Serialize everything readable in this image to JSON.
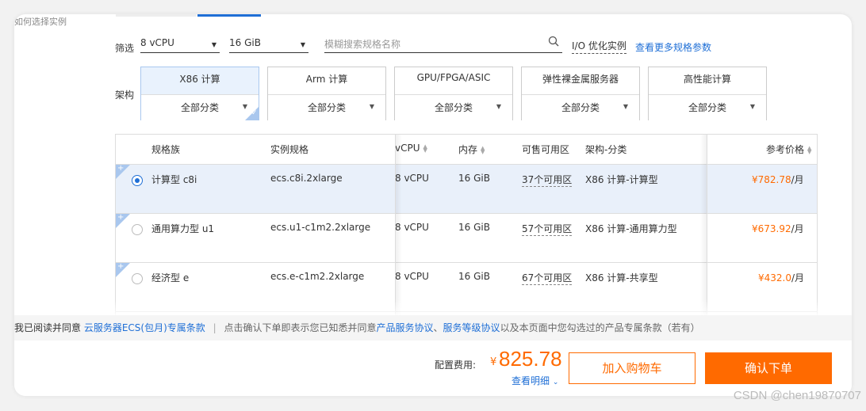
{
  "section_title": "如何选择实例",
  "filter": {
    "label": "筛选",
    "vcpu": "8 vCPU",
    "memory": "16 GiB",
    "search_placeholder": "模糊搜索规格名称",
    "io_optimized": "I/O 优化实例",
    "more_params": "查看更多规格参数"
  },
  "arch": {
    "label": "架构",
    "options": [
      {
        "title": "X86 计算",
        "sub": "全部分类",
        "selected": true
      },
      {
        "title": "Arm 计算",
        "sub": "全部分类"
      },
      {
        "title": "GPU/FPGA/ASIC",
        "sub": "全部分类"
      },
      {
        "title": "弹性裸金属服务器",
        "sub": "全部分类"
      },
      {
        "title": "高性能计算",
        "sub": "全部分类"
      }
    ]
  },
  "table": {
    "headers": {
      "family": "规格族",
      "spec": "实例规格",
      "vcpu": "vCPU",
      "memory": "内存",
      "zones": "可售可用区",
      "arch": "架构-分类",
      "price": "参考价格"
    },
    "rows": [
      {
        "family": "计算型 c8i",
        "spec": "ecs.c8i.2xlarge",
        "vcpu": "8 vCPU",
        "memory": "16 GiB",
        "zones": "37个可用区",
        "arch": "X86 计算-计算型",
        "price": "¥782.78",
        "unit": "/月",
        "selected": true
      },
      {
        "family": "通用算力型 u1",
        "spec": "ecs.u1-c1m2.2xlarge",
        "vcpu": "8 vCPU",
        "memory": "16 GiB",
        "zones": "57个可用区",
        "arch": "X86 计算-通用算力型",
        "price": "¥673.92",
        "unit": "/月",
        "selected": false
      },
      {
        "family": "经济型 e",
        "spec": "ecs.e-c1m2.2xlarge",
        "vcpu": "8 vCPU",
        "memory": "16 GiB",
        "zones": "67个可用区",
        "arch": "X86 计算-共享型",
        "price": "¥432.0",
        "unit": "/月",
        "selected": false
      }
    ]
  },
  "agreement": {
    "prefix": "我已阅读并同意",
    "terms_link": "云服务器ECS(包月)专属条款",
    "notice_start": "点击确认下单即表示您已知悉并同意",
    "product_agreement": "产品服务协议",
    "comma": "、",
    "sla": "服务等级协议",
    "notice_end": "以及本页面中您勾选过的产品专属条款（若有）"
  },
  "footer": {
    "cost_label": "配置费用:",
    "currency": "¥",
    "amount": "825.78",
    "detail": "查看明细",
    "add_to_cart": "加入购物车",
    "confirm": "确认下单"
  },
  "watermark": "CSDN @chen19870707",
  "colors": {
    "accent": "#ff6a00",
    "link": "#1f6fd6",
    "selected_bg": "#e9f0fa"
  }
}
